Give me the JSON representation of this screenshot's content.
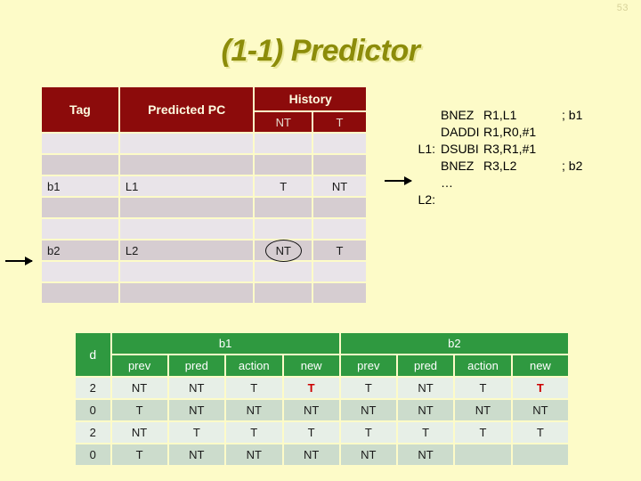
{
  "slide": {
    "page_number": "53",
    "title": "(1-1) Predictor",
    "background_color": "#fdfbc8",
    "title_color": "#8c8c0a"
  },
  "btb_table": {
    "accent_color": "#8c0b0b",
    "headers": {
      "tag": "Tag",
      "predicted_pc": "Predicted PC",
      "history": "History",
      "history_nt": "NT",
      "history_t": "T"
    },
    "rows": [
      {
        "tag": "",
        "predicted_pc": "",
        "nt": "",
        "t": "",
        "nt_circled": false
      },
      {
        "tag": "",
        "predicted_pc": "",
        "nt": "",
        "t": "",
        "nt_circled": false
      },
      {
        "tag": "b1",
        "predicted_pc": "L1",
        "nt": "T",
        "t": "NT",
        "nt_circled": false
      },
      {
        "tag": "",
        "predicted_pc": "",
        "nt": "",
        "t": "",
        "nt_circled": false
      },
      {
        "tag": "",
        "predicted_pc": "",
        "nt": "",
        "t": "",
        "nt_circled": false
      },
      {
        "tag": "b2",
        "predicted_pc": "L2",
        "nt": "NT",
        "t": "T",
        "nt_circled": true
      },
      {
        "tag": "",
        "predicted_pc": "",
        "nt": "",
        "t": "",
        "nt_circled": false
      },
      {
        "tag": "",
        "predicted_pc": "",
        "nt": "",
        "t": "",
        "nt_circled": false
      }
    ]
  },
  "code": {
    "lines": [
      {
        "label": "",
        "op": "BNEZ",
        "args": "R1,L1",
        "comment": "; b1"
      },
      {
        "label": "",
        "op": "DADDI",
        "args": "R1,R0,#1",
        "comment": ""
      },
      {
        "label": "L1:",
        "op": "DSUBI",
        "args": "R3,R1,#1",
        "comment": ""
      },
      {
        "label": "",
        "op": "BNEZ",
        "args": "R3,L2",
        "comment": "; b2"
      },
      {
        "label": "",
        "op": "…",
        "args": "",
        "comment": ""
      },
      {
        "label": "L2:",
        "op": "",
        "args": "",
        "comment": ""
      }
    ]
  },
  "trace_table": {
    "accent_color": "#2f9940",
    "highlight_color": "#cc0000",
    "d_header": "d",
    "groups": [
      {
        "name": "b1",
        "columns": [
          "prev",
          "pred",
          "action",
          "new"
        ]
      },
      {
        "name": "b2",
        "columns": [
          "prev",
          "pred",
          "action",
          "new"
        ]
      }
    ],
    "rows": [
      {
        "d": "2",
        "b1": [
          "NT",
          "NT",
          "T",
          "T"
        ],
        "b1_hl": [
          false,
          false,
          false,
          true
        ],
        "b2": [
          "T",
          "NT",
          "T",
          "T"
        ],
        "b2_hl": [
          false,
          false,
          false,
          true
        ]
      },
      {
        "d": "0",
        "b1": [
          "T",
          "NT",
          "NT",
          "NT"
        ],
        "b1_hl": [
          false,
          false,
          false,
          false
        ],
        "b2": [
          "NT",
          "NT",
          "NT",
          "NT"
        ],
        "b2_hl": [
          false,
          false,
          false,
          false
        ]
      },
      {
        "d": "2",
        "b1": [
          "NT",
          "T",
          "T",
          "T"
        ],
        "b1_hl": [
          false,
          false,
          false,
          false
        ],
        "b2": [
          "T",
          "T",
          "T",
          "T"
        ],
        "b2_hl": [
          false,
          false,
          false,
          false
        ]
      },
      {
        "d": "0",
        "b1": [
          "T",
          "NT",
          "NT",
          "NT"
        ],
        "b1_hl": [
          false,
          false,
          false,
          false
        ],
        "b2": [
          "NT",
          "NT",
          "",
          ""
        ],
        "b2_hl": [
          false,
          false,
          false,
          false
        ]
      }
    ]
  }
}
